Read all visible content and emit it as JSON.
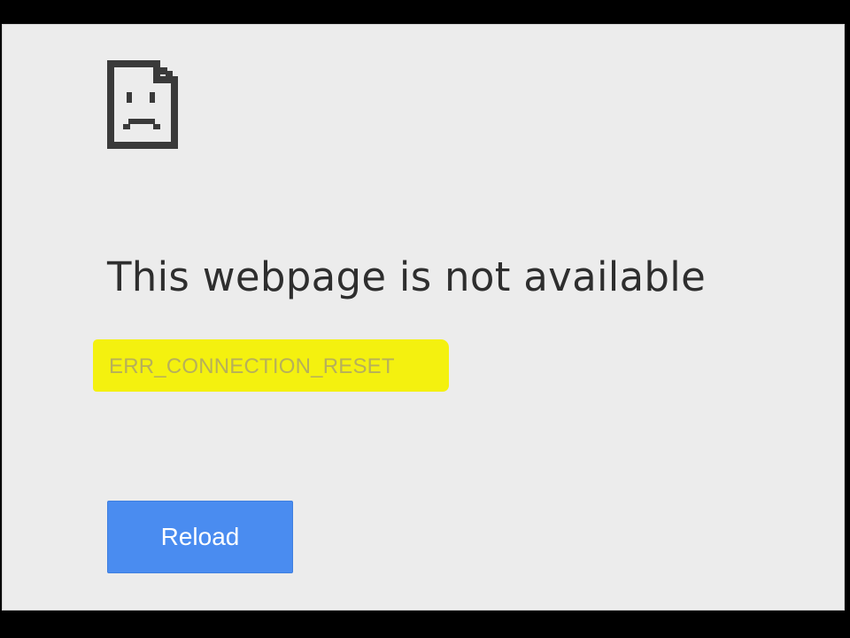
{
  "error_page": {
    "icon": "sad-document-icon",
    "title": "This webpage is not available",
    "error_code": "ERR_CONNECTION_RESET",
    "reload_label": "Reload"
  },
  "colors": {
    "page_background": "#ececec",
    "title_text": "#2e2e2e",
    "error_code_text": "#b7b05a",
    "highlight": "#f4f10f",
    "reload_button": "#4a8cf0",
    "reload_text": "#ffffff",
    "letterbox": "#000000"
  }
}
